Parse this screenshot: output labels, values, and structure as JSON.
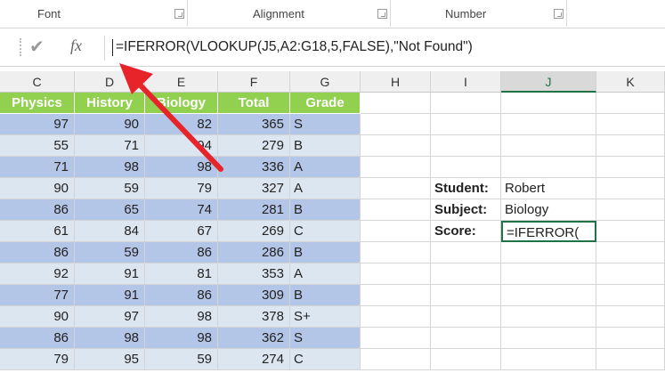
{
  "ribbon": {
    "groups": [
      "Font",
      "Alignment",
      "Number"
    ]
  },
  "formula_bar": {
    "cancel_icon": "check-icon",
    "fx_label": "fx",
    "formula": "=IFERROR(VLOOKUP(J5,A2:G18,5,FALSE),\"Not Found\")"
  },
  "columns": [
    "C",
    "D",
    "E",
    "F",
    "G",
    "H",
    "I",
    "J",
    "K"
  ],
  "selected_column": "J",
  "table": {
    "headers": [
      "Physics",
      "History",
      "Biology",
      "Total",
      "Grade"
    ],
    "rows": [
      [
        "97",
        "90",
        "82",
        "365",
        "S"
      ],
      [
        "55",
        "71",
        "94",
        "279",
        "B"
      ],
      [
        "71",
        "98",
        "98",
        "336",
        "A"
      ],
      [
        "90",
        "59",
        "79",
        "327",
        "A"
      ],
      [
        "86",
        "65",
        "74",
        "281",
        "B"
      ],
      [
        "61",
        "84",
        "67",
        "269",
        "C"
      ],
      [
        "86",
        "59",
        "86",
        "286",
        "B"
      ],
      [
        "92",
        "91",
        "81",
        "353",
        "A"
      ],
      [
        "77",
        "91",
        "86",
        "309",
        "B"
      ],
      [
        "90",
        "97",
        "98",
        "378",
        "S+"
      ],
      [
        "86",
        "98",
        "98",
        "362",
        "S"
      ],
      [
        "79",
        "95",
        "59",
        "274",
        "C"
      ]
    ]
  },
  "lookup": {
    "student_label": "Student:",
    "student_value": "Robert",
    "subject_label": "Subject:",
    "subject_value": "Biology",
    "score_label": "Score:",
    "score_value": "=IFERROR("
  },
  "colors": {
    "header_green": "#92d050",
    "band_dark": "#b4c6e7",
    "band_light": "#dce6f1",
    "arrow_red": "#e8242b",
    "active_cell": "#217346"
  }
}
